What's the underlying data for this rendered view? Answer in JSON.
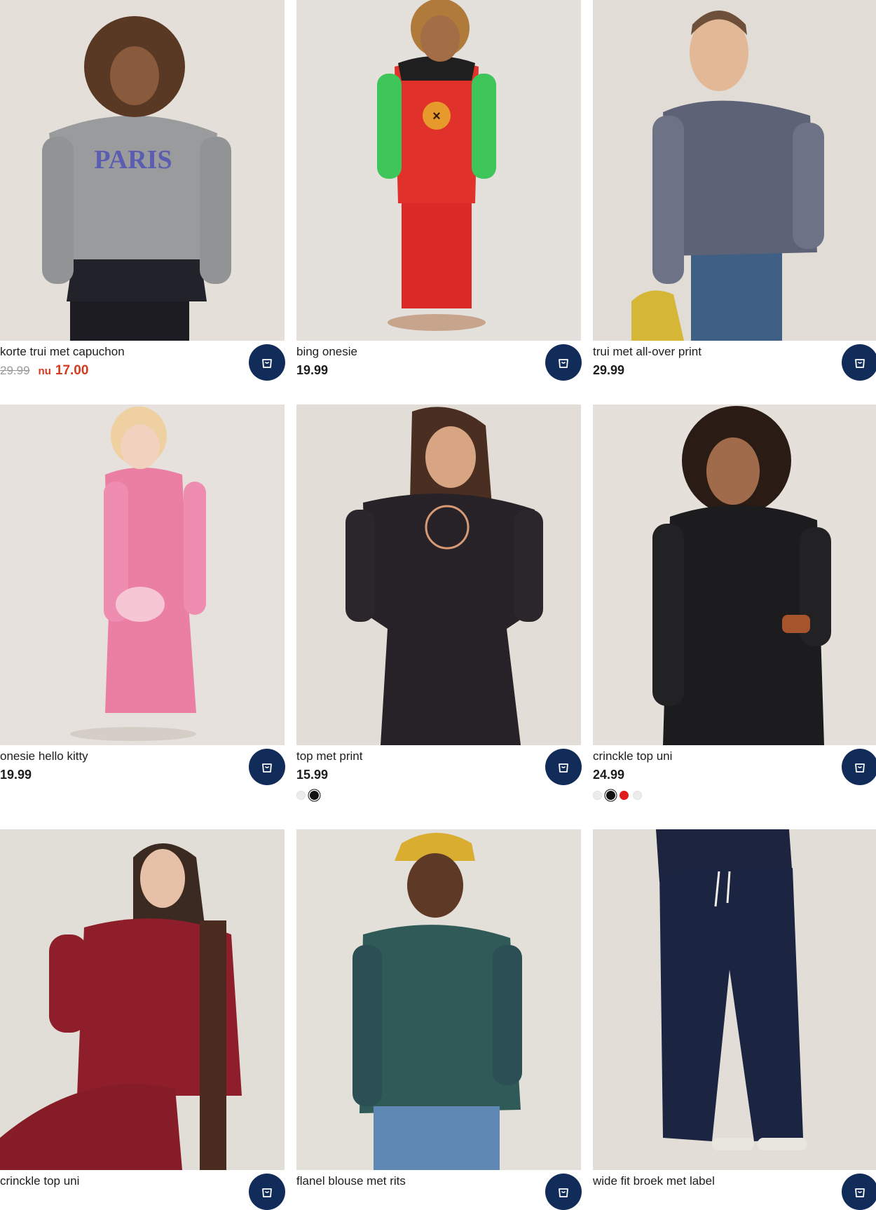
{
  "products": [
    {
      "title": "korte trui met capuchon",
      "old_price": "29.99",
      "now_label": "nu",
      "sale_price": "17.00"
    },
    {
      "title": "bing onesie",
      "price": "19.99"
    },
    {
      "title": "trui met all-over print",
      "price": "29.99"
    },
    {
      "title": "onesie hello kitty",
      "price": "19.99"
    },
    {
      "title": "top met print",
      "price": "15.99",
      "swatch_colors": [
        "#ececec",
        "#111111"
      ],
      "selected_swatch": 1
    },
    {
      "title": "crinckle top uni",
      "price": "24.99",
      "swatch_colors": [
        "#ececec",
        "#111111",
        "#e01b1b",
        "#ececec"
      ],
      "selected_swatch": 1
    },
    {
      "title": "crinckle top uni"
    },
    {
      "title": "flanel blouse met rits"
    },
    {
      "title": "wide fit broek met label"
    }
  ],
  "colors": {
    "cart_button": "#122c5a",
    "sale": "#d63a1e",
    "photo_background": "#e3ded8"
  },
  "icons": {
    "cart": "shopping-bag-icon"
  }
}
